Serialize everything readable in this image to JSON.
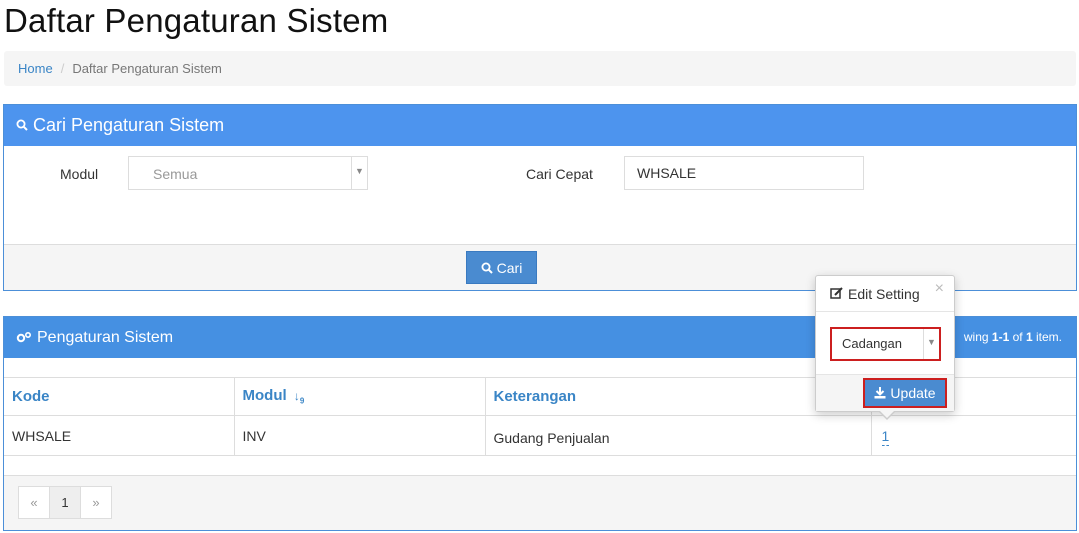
{
  "page": {
    "title": "Daftar Pengaturan Sistem"
  },
  "breadcrumb": {
    "home": "Home",
    "current": "Daftar Pengaturan Sistem"
  },
  "search": {
    "title": "Cari Pengaturan Sistem",
    "modul_label": "Modul",
    "modul_value": "Semua",
    "quick_label": "Cari Cepat",
    "quick_value": "WHSALE",
    "submit_label": "Cari"
  },
  "list": {
    "title": "Pengaturan Sistem",
    "summary_prefix": "wing",
    "summary_range": "1-1",
    "summary_of": "of",
    "summary_total": "1",
    "summary_suffix": "item.",
    "columns": [
      "Kode",
      "Modul",
      "Keterangan",
      ""
    ],
    "rows": [
      {
        "kode": "WHSALE",
        "modul": "INV",
        "keterangan": "Gudang Penjualan",
        "nilai": "1"
      }
    ],
    "pager": {
      "prev": "«",
      "page": "1",
      "next": "»"
    }
  },
  "popover": {
    "title": "Edit Setting",
    "close": "×",
    "select_value": "Cadangan",
    "update_label": "Update"
  },
  "icons": {
    "search": "search-icon",
    "gears": "gears-icon",
    "edit": "edit-icon",
    "download": "download-icon",
    "sort": "sort-numeric-icon"
  },
  "colors": {
    "primary": "#4d94ee",
    "link": "#3a85c6",
    "highlight": "#cc1f1f"
  }
}
